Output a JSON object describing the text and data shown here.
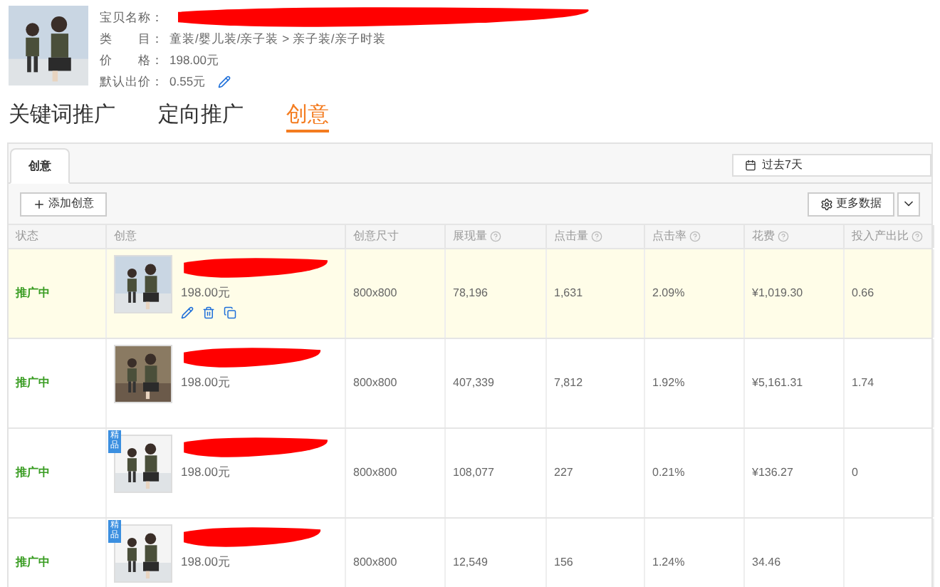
{
  "product": {
    "fields": [
      {
        "label": "宝贝名称：",
        "editable": false
      },
      {
        "label": "类　　目：",
        "value": "童装/婴儿装/亲子装 > 亲子装/亲子时装",
        "editable": false
      },
      {
        "label": "价　　格：",
        "value": "198.00元",
        "editable": false
      },
      {
        "label": "默认出价：",
        "value": "0.55元",
        "editable": true
      }
    ]
  },
  "main_tabs": [
    {
      "label": "关键词推广",
      "selected": false
    },
    {
      "label": "定向推广",
      "selected": false
    },
    {
      "label": "创意",
      "selected": true
    }
  ],
  "sub_tab": {
    "label": "创意"
  },
  "date_range": "过去7天",
  "add_button": "添加创意",
  "more_button": "更多数据",
  "columns": [
    {
      "label": "状态",
      "help": false
    },
    {
      "label": "创意",
      "help": false
    },
    {
      "label": "创意尺寸",
      "help": false
    },
    {
      "label": "展现量",
      "help": true
    },
    {
      "label": "点击量",
      "help": true
    },
    {
      "label": "点击率",
      "help": true
    },
    {
      "label": "花费",
      "help": true
    },
    {
      "label": "投入产出比",
      "help": true
    }
  ],
  "rows": [
    {
      "status": "推广中",
      "price": "198.00元",
      "highlighted": true,
      "actions": true,
      "size": "800x800",
      "impressions": "78,196",
      "clicks": "1,631",
      "ctr": "2.09%",
      "cost": "¥1,019.30",
      "roi": "0.66"
    },
    {
      "status": "推广中",
      "price": "198.00元",
      "highlighted": false,
      "actions": false,
      "size": "800x800",
      "impressions": "407,339",
      "clicks": "7,812",
      "ctr": "1.92%",
      "cost": "¥5,161.31",
      "roi": "1.74"
    },
    {
      "status": "推广中",
      "price": "198.00元",
      "badge": "精品",
      "highlighted": false,
      "actions": false,
      "size": "800x800",
      "impressions": "108,077",
      "clicks": "227",
      "ctr": "0.21%",
      "cost": "¥136.27",
      "roi": "0"
    },
    {
      "status": "推广中",
      "price": "198.00元",
      "badge": "精品",
      "highlighted": false,
      "actions": false,
      "size": "800x800",
      "impressions": "12,549",
      "clicks": "156",
      "ctr": "1.24%",
      "cost": "34.46"
    }
  ]
}
